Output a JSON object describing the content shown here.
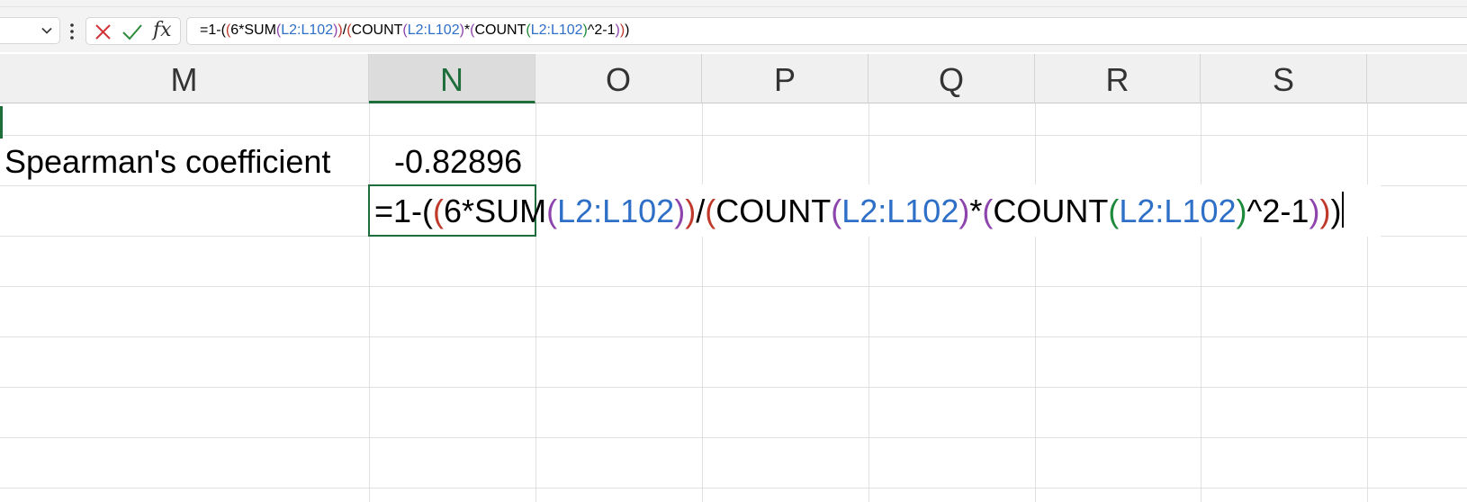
{
  "formula_bar": {
    "name_box_value": "",
    "formula_text": "=1-((6*SUM(L2:L102))/(COUNT(L2:L102)*(COUNT(L2:L102)^2-1)))",
    "formula_parts": [
      "=1-(",
      "(",
      "6*SUM",
      "(",
      "L2:L102",
      ")",
      ")",
      "/",
      "(",
      "COUNT",
      "(",
      "L2:L102",
      ")",
      "*",
      "(",
      "COUNT",
      "(",
      "L2:L102",
      ")",
      "^2-1",
      ")",
      ")",
      ")"
    ],
    "formula_part_colors": [
      "#000000",
      "#c0392b",
      "#000000",
      "#8e44ad",
      "#2e6fc7",
      "#8e44ad",
      "#c0392b",
      "#000000",
      "#c0392b",
      "#000000",
      "#8e44ad",
      "#2e6fc7",
      "#8e44ad",
      "#000000",
      "#8e44ad",
      "#000000",
      "#1e8a3c",
      "#2e6fc7",
      "#1e8a3c",
      "#000000",
      "#8e44ad",
      "#c0392b",
      "#000000"
    ],
    "fx_label": "fx",
    "icons": [
      "chevron-down-icon",
      "more-vertical-icon",
      "cancel-icon",
      "checkmark-icon",
      "fx-icon"
    ]
  },
  "columns": [
    {
      "label": "M",
      "selected": false
    },
    {
      "label": "N",
      "selected": true
    },
    {
      "label": "O",
      "selected": false
    },
    {
      "label": "P",
      "selected": false
    },
    {
      "label": "Q",
      "selected": false
    },
    {
      "label": "R",
      "selected": false
    },
    {
      "label": "S",
      "selected": false
    }
  ],
  "cells": {
    "label_text": "Spearman's coefficient",
    "value_text": "-0.82896"
  },
  "colors": {
    "accent_green": "#1e6e3c",
    "ref_blue": "#2e6fc7",
    "paren_red": "#c0392b",
    "paren_purple": "#8e44ad",
    "paren_green": "#1e8a3c"
  }
}
